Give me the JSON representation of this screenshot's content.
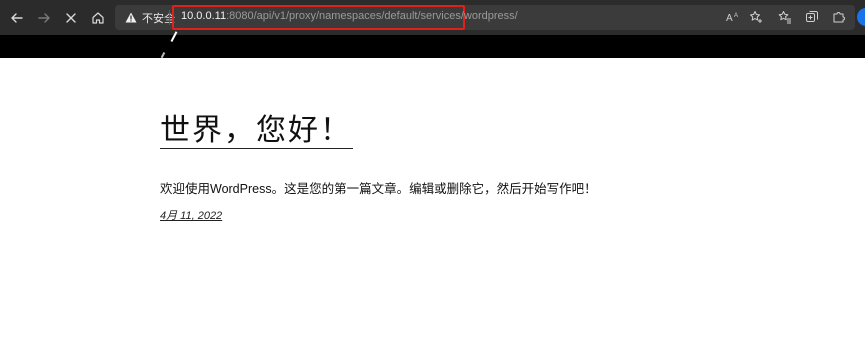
{
  "browser": {
    "security_label": "不安全",
    "url_host": "10.0.0.11",
    "url_path": ":8080/api/v1/proxy/namespaces/default/services/wordpress/",
    "read_aloud_label": "Aᴬ"
  },
  "post": {
    "title": "世界，您好！",
    "body": "欢迎使用WordPress。这是您的第一篇文章。编辑或删除它，然后开始写作吧！",
    "date": "4月 11, 2022"
  }
}
